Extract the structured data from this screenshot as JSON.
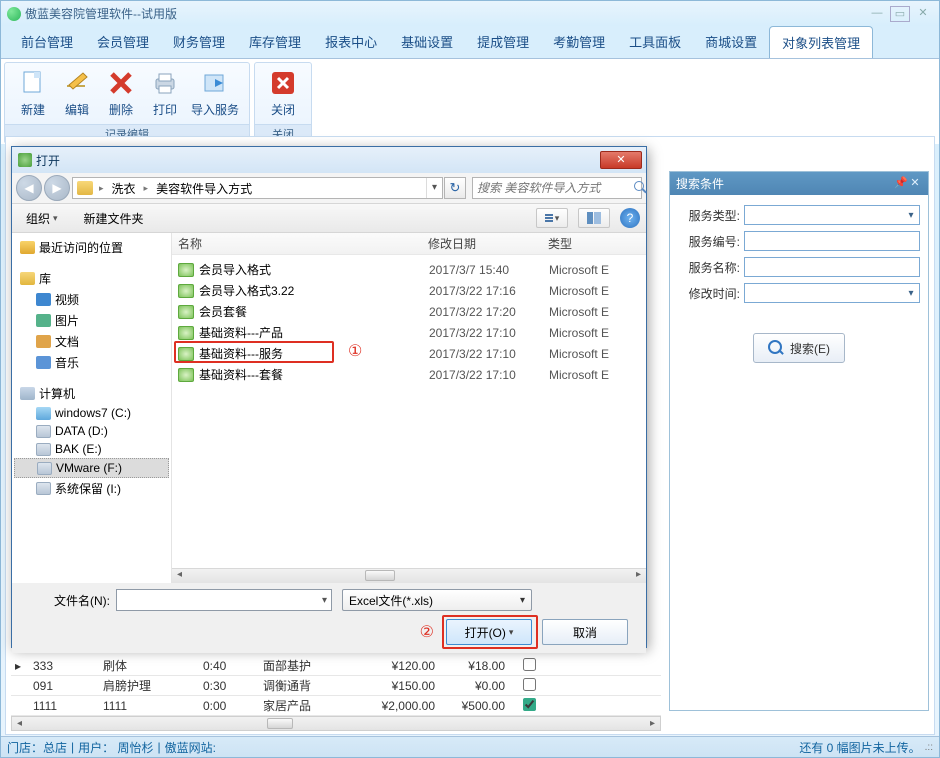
{
  "app": {
    "title": "傲蓝美容院管理软件--试用版"
  },
  "menu": {
    "items": [
      "前台管理",
      "会员管理",
      "财务管理",
      "库存管理",
      "报表中心",
      "基础设置",
      "提成管理",
      "考勤管理",
      "工具面板",
      "商城设置",
      "对象列表管理"
    ],
    "active_index": 10
  },
  "ribbon": {
    "group1_label": "记录编辑",
    "group2_label": "关闭",
    "btns": {
      "new": "新建",
      "edit": "编辑",
      "delete": "删除",
      "print": "打印",
      "import": "导入服务",
      "close": "关闭"
    }
  },
  "search_panel": {
    "title": "搜索条件",
    "fields": {
      "type": "服务类型:",
      "code": "服务编号:",
      "name": "服务名称:",
      "modtime": "修改时间:"
    },
    "button": "搜索(E)"
  },
  "peek_rows": [
    {
      "code": "333",
      "name": "刷体",
      "duration": "0:40",
      "cat": "面部基护",
      "price": "¥120.00",
      "cost": "¥18.00",
      "chk": false
    },
    {
      "code": "091",
      "name": "肩膀护理",
      "duration": "0:30",
      "cat": "调衡通背",
      "price": "¥150.00",
      "cost": "¥0.00",
      "chk": false
    },
    {
      "code": "1111",
      "name": "1111",
      "duration": "0:00",
      "cat": "家居产品",
      "price": "¥2,000.00",
      "cost": "¥500.00",
      "chk": true
    }
  ],
  "statusbar": {
    "left_store": "门店：总店",
    "left_user": "用户： 周怡杉",
    "left_site": "傲蓝网站:",
    "right": "还有 0 幅图片未上传。"
  },
  "dialog": {
    "title": "打开",
    "breadcrumb": [
      "洗衣",
      "美容软件导入方式"
    ],
    "search_placeholder": "搜索 美容软件导入方式",
    "toolbar": {
      "org": "组织",
      "newfolder": "新建文件夹"
    },
    "tree": {
      "recent": "最近访问的位置",
      "lib": "库",
      "video": "视频",
      "picture": "图片",
      "doc": "文档",
      "music": "音乐",
      "computer": "计算机",
      "drives": [
        "windows7 (C:)",
        "DATA (D:)",
        "BAK (E:)",
        "VMware (F:)",
        "系统保留 (I:)"
      ],
      "selected_drive_index": 3
    },
    "columns": {
      "name": "名称",
      "date": "修改日期",
      "type": "类型"
    },
    "files": [
      {
        "name": "会员导入格式",
        "date": "2017/3/7 15:40",
        "type": "Microsoft E"
      },
      {
        "name": "会员导入格式3.22",
        "date": "2017/3/22 17:16",
        "type": "Microsoft E"
      },
      {
        "name": "会员套餐",
        "date": "2017/3/22 17:20",
        "type": "Microsoft E"
      },
      {
        "name": "基础资料---产品",
        "date": "2017/3/22 17:10",
        "type": "Microsoft E"
      },
      {
        "name": "基础资料---服务",
        "date": "2017/3/22 17:10",
        "type": "Microsoft E"
      },
      {
        "name": "基础资料---套餐",
        "date": "2017/3/22 17:10",
        "type": "Microsoft E"
      }
    ],
    "filename_label": "文件名(N):",
    "filename_value": "",
    "filetype": "Excel文件(*.xls)",
    "open_btn": "打开(O)",
    "cancel_btn": "取消",
    "callouts": {
      "one": "①",
      "two": "②"
    }
  }
}
